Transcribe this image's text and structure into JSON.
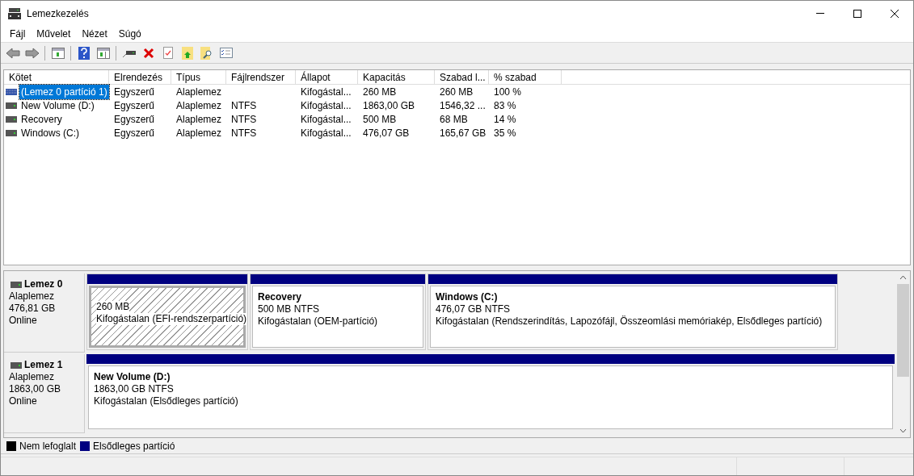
{
  "window": {
    "title": "Lemezkezelés"
  },
  "menu": [
    "Fájl",
    "Művelet",
    "Nézet",
    "Súgó"
  ],
  "table": {
    "columns": [
      "Kötet",
      "Elrendezés",
      "Típus",
      "Fájlrendszer",
      "Állapot",
      "Kapacitás",
      "Szabad l...",
      "% szabad"
    ],
    "rows": [
      {
        "selected": true,
        "cells": [
          "(Lemez 0 partíció 1)",
          "Egyszerű",
          "Alaplemez",
          "",
          "Kifogástal...",
          "260 MB",
          "260 MB",
          "100 %"
        ]
      },
      {
        "selected": false,
        "cells": [
          "New Volume (D:)",
          "Egyszerű",
          "Alaplemez",
          "NTFS",
          "Kifogástal...",
          "1863,00 GB",
          "1546,32 ...",
          "83 %"
        ]
      },
      {
        "selected": false,
        "cells": [
          "Recovery",
          "Egyszerű",
          "Alaplemez",
          "NTFS",
          "Kifogástal...",
          "500 MB",
          "68 MB",
          "14 %"
        ]
      },
      {
        "selected": false,
        "cells": [
          "Windows (C:)",
          "Egyszerű",
          "Alaplemez",
          "NTFS",
          "Kifogástal...",
          "476,07 GB",
          "165,67 GB",
          "35 %"
        ]
      }
    ]
  },
  "disks": [
    {
      "name": "Lemez 0",
      "type": "Alaplemez",
      "size": "476,81 GB",
      "status": "Online",
      "partitions": [
        {
          "selected": true,
          "size": "260 MB",
          "status": "Kifogástalan (EFI-rendszerpartíció)"
        },
        {
          "selected": false,
          "name": "Recovery",
          "size": "500 MB NTFS",
          "status": "Kifogástalan (OEM-partíció)"
        },
        {
          "selected": false,
          "name": "Windows  (C:)",
          "size": "476,07 GB NTFS",
          "status": "Kifogástalan (Rendszerindítás, Lapozófájl, Összeomlási memóriakép, Elsődleges partíció)"
        }
      ]
    },
    {
      "name": "Lemez 1",
      "type": "Alaplemez",
      "size": "1863,00 GB",
      "status": "Online",
      "partitions": [
        {
          "selected": false,
          "name": "New Volume  (D:)",
          "size": "1863,00 GB NTFS",
          "status": "Kifogástalan (Elsődleges partíció)"
        }
      ]
    }
  ],
  "legend": [
    {
      "label": "Nem lefoglalt",
      "color": "#000000"
    },
    {
      "label": "Elsődleges partíció",
      "color": "#000080"
    }
  ]
}
